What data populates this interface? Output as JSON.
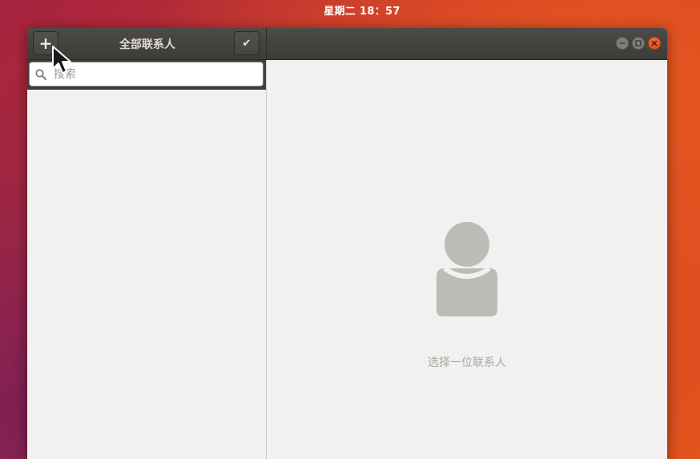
{
  "topbar": {
    "clock": "星期二 18：57"
  },
  "window": {
    "title": "全部联系人",
    "add_label": "+",
    "select_label": "✔",
    "controls": {
      "minimize": "minimize-icon",
      "maximize": "maximize-icon",
      "close": "close-icon"
    }
  },
  "sidebar": {
    "search": {
      "placeholder": "搜索",
      "value": "",
      "icon": "search-icon"
    }
  },
  "content": {
    "empty_state": {
      "icon": "avatar-placeholder-icon",
      "label": "选择一位联系人"
    }
  },
  "colors": {
    "headerbar": "#3f3e3a",
    "window_bg": "#f2f1f0",
    "close_button": "#e9541d",
    "empty_text": "#a9a7a3",
    "avatar": "#bdbbb8"
  }
}
